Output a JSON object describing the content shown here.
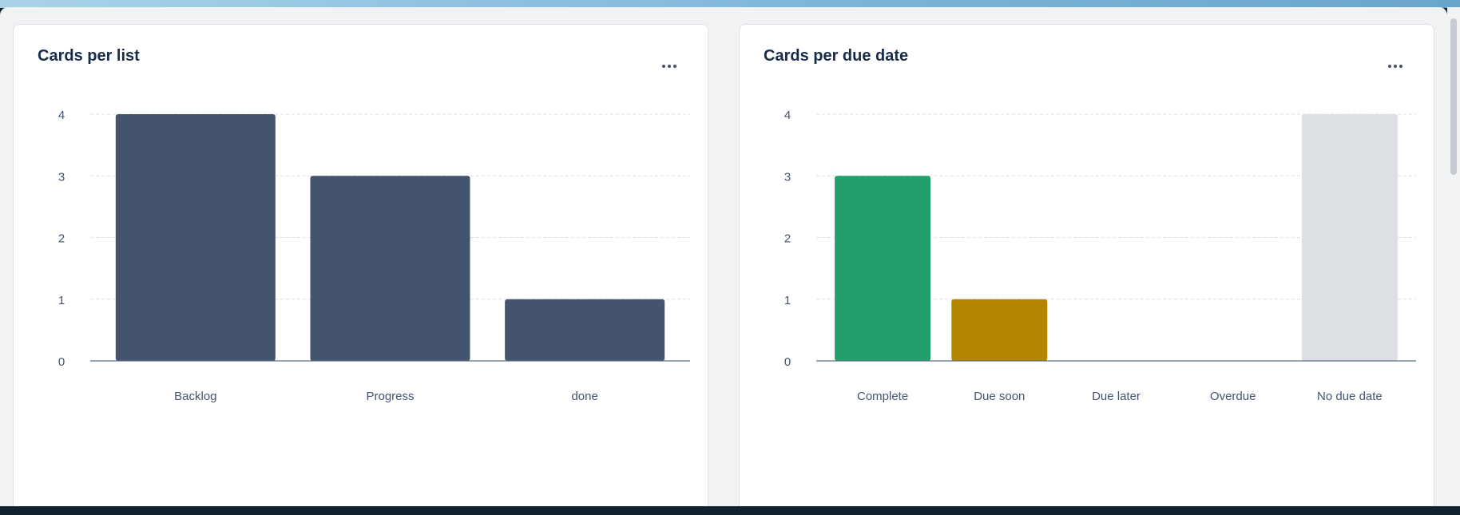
{
  "panels": [
    {
      "title": "Cards per list",
      "more_icon": "more-horizontal-icon",
      "chart_data": {
        "type": "bar",
        "categories": [
          "Backlog",
          "Progress",
          "done"
        ],
        "values": [
          4,
          3,
          1
        ],
        "colors": [
          "#44546f",
          "#44546f",
          "#44546f"
        ],
        "ylim": [
          0,
          4
        ],
        "yticks": [
          "0",
          "1",
          "2",
          "3",
          "4"
        ],
        "grid": true
      }
    },
    {
      "title": "Cards per due date",
      "more_icon": "more-horizontal-icon",
      "chart_data": {
        "type": "bar",
        "categories": [
          "Complete",
          "Due soon",
          "Due later",
          "Overdue",
          "No due date"
        ],
        "values": [
          3,
          1,
          0,
          0,
          4
        ],
        "colors": [
          "#22a06b",
          "#b38600",
          "#b38600",
          "#c9372c",
          "#dcdfe4"
        ],
        "ylim": [
          0,
          4
        ],
        "yticks": [
          "0",
          "1",
          "2",
          "3",
          "4"
        ],
        "grid": true
      }
    }
  ]
}
